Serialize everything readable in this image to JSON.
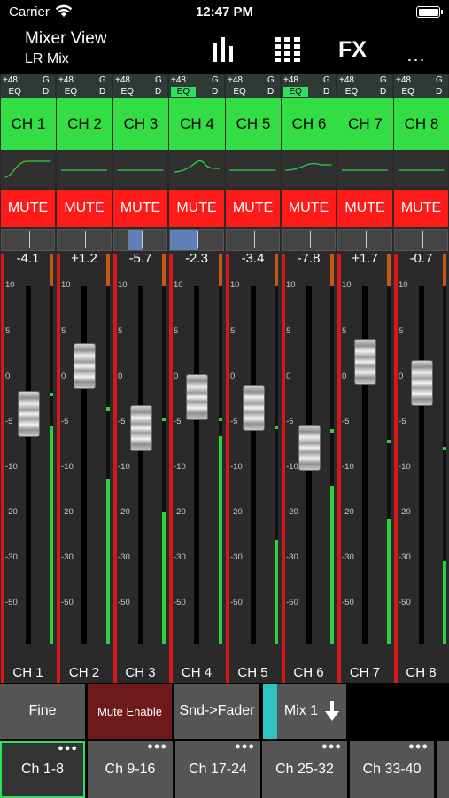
{
  "status": {
    "carrier": "Carrier",
    "time": "12:47 PM"
  },
  "header": {
    "title": "Mixer View",
    "subtitle": "LR Mix",
    "fx_label": "FX",
    "more_label": "..."
  },
  "switch_labels": {
    "phantom": "+48",
    "gate": "G",
    "eq": "EQ",
    "dyn": "D"
  },
  "mute_label": "MUTE",
  "scale_ticks": [
    "10",
    "5",
    "0",
    "-5",
    "-10",
    "-20",
    "-30",
    "-50"
  ],
  "channels": [
    {
      "name": "CH 1",
      "gain": "-4.1",
      "fader_db": -4.1,
      "eq_on": false,
      "pan": 0,
      "meter_level": 0.61,
      "peak": 0.7,
      "curve": "hp"
    },
    {
      "name": "CH 2",
      "gain": "+1.2",
      "fader_db": 1.2,
      "eq_on": false,
      "pan": 0,
      "meter_level": 0.46,
      "peak": 0.66,
      "curve": "flat"
    },
    {
      "name": "CH 3",
      "gain": "-5.7",
      "fader_db": -5.7,
      "eq_on": false,
      "pan": -0.5,
      "meter_level": 0.37,
      "peak": 0.63,
      "curve": "flat"
    },
    {
      "name": "CH 4",
      "gain": "-2.3",
      "fader_db": -2.3,
      "eq_on": true,
      "pan": -1,
      "meter_level": 0.58,
      "peak": 0.63,
      "curve": "bump"
    },
    {
      "name": "CH 5",
      "gain": "-3.4",
      "fader_db": -3.4,
      "eq_on": false,
      "pan": 0,
      "meter_level": 0.29,
      "peak": 0.61,
      "curve": "flat"
    },
    {
      "name": "CH 6",
      "gain": "-7.8",
      "fader_db": -7.8,
      "eq_on": true,
      "pan": 0,
      "meter_level": 0.44,
      "peak": 0.6,
      "curve": "bump2"
    },
    {
      "name": "CH 7",
      "gain": "+1.7",
      "fader_db": 1.7,
      "eq_on": false,
      "pan": 0,
      "meter_level": 0.35,
      "peak": 0.57,
      "curve": "flat"
    },
    {
      "name": "CH 8",
      "gain": "-0.7",
      "fader_db": -0.7,
      "eq_on": false,
      "pan": 0,
      "meter_level": 0.23,
      "peak": 0.55,
      "curve": "flat"
    }
  ],
  "controls": {
    "fine": "Fine",
    "mute_enable": "Mute Enable",
    "snd_fader": "Snd->Fader",
    "mix": "Mix 1"
  },
  "banks": [
    {
      "label": "Ch 1-8",
      "selected": true
    },
    {
      "label": "Ch 9-16",
      "selected": false
    },
    {
      "label": "Ch 17-24",
      "selected": false
    },
    {
      "label": "Ch 25-32",
      "selected": false
    },
    {
      "label": "Ch 33-40",
      "selected": false
    }
  ],
  "colors": {
    "channel_green": "#33dd44",
    "mute_red": "#ff1a1a",
    "meter_green": "#2ed23c",
    "teal": "#2cc6c0",
    "pan_blue": "#5f7fb6"
  }
}
